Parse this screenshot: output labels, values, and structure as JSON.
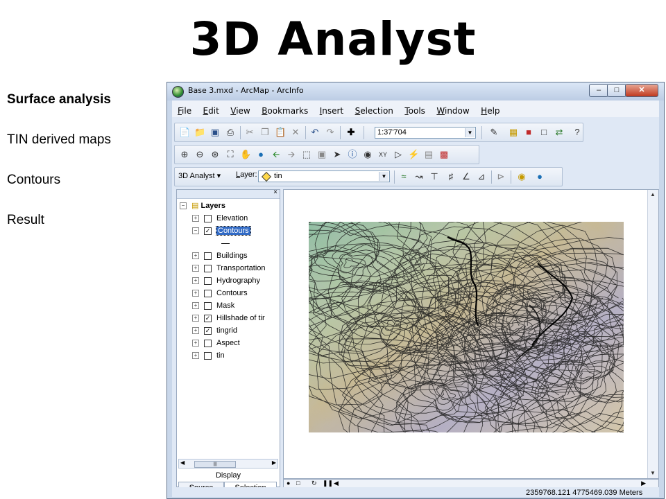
{
  "slide": {
    "title": "3D Analyst",
    "bullets": [
      "Surface analysis",
      "TIN derived maps",
      "Contours",
      "Result"
    ]
  },
  "window": {
    "title": "Base 3.mxd - ArcMap - ArcInfo",
    "controls": {
      "minimize": "–",
      "maximize": "□",
      "close": "✕"
    }
  },
  "menu": [
    "File",
    "Edit",
    "View",
    "Bookmarks",
    "Insert",
    "Selection",
    "Tools",
    "Window",
    "Help"
  ],
  "standard_toolbar": {
    "scale": "1:37'704"
  },
  "analyst_toolbar": {
    "button": "3D Analyst ▾",
    "layer_label": "Layer:",
    "layer_value": "tin"
  },
  "toc": {
    "close": "×",
    "root": "Layers",
    "layers": [
      {
        "name": "Elevation",
        "checked": false,
        "selected": false
      },
      {
        "name": "Contours",
        "checked": true,
        "selected": true
      },
      {
        "name": "Buildings",
        "checked": false,
        "selected": false
      },
      {
        "name": "Transportation",
        "checked": false,
        "selected": false
      },
      {
        "name": "Hydrography",
        "checked": false,
        "selected": false
      },
      {
        "name": "Contours",
        "checked": false,
        "selected": false
      },
      {
        "name": "Mask",
        "checked": false,
        "selected": false
      },
      {
        "name": "Hillshade of tir",
        "checked": true,
        "selected": false
      },
      {
        "name": "tingrid",
        "checked": true,
        "selected": false
      },
      {
        "name": "Aspect",
        "checked": false,
        "selected": false
      },
      {
        "name": "tin",
        "checked": false,
        "selected": false
      }
    ],
    "tab_group_title": "Display",
    "tabs": [
      "Source",
      "Selection"
    ]
  },
  "status": {
    "coordinates": "2359768.121  4775469.039 Meters"
  },
  "colors": {
    "window_frame": "#c9d7ea",
    "selection": "#316ac5"
  }
}
